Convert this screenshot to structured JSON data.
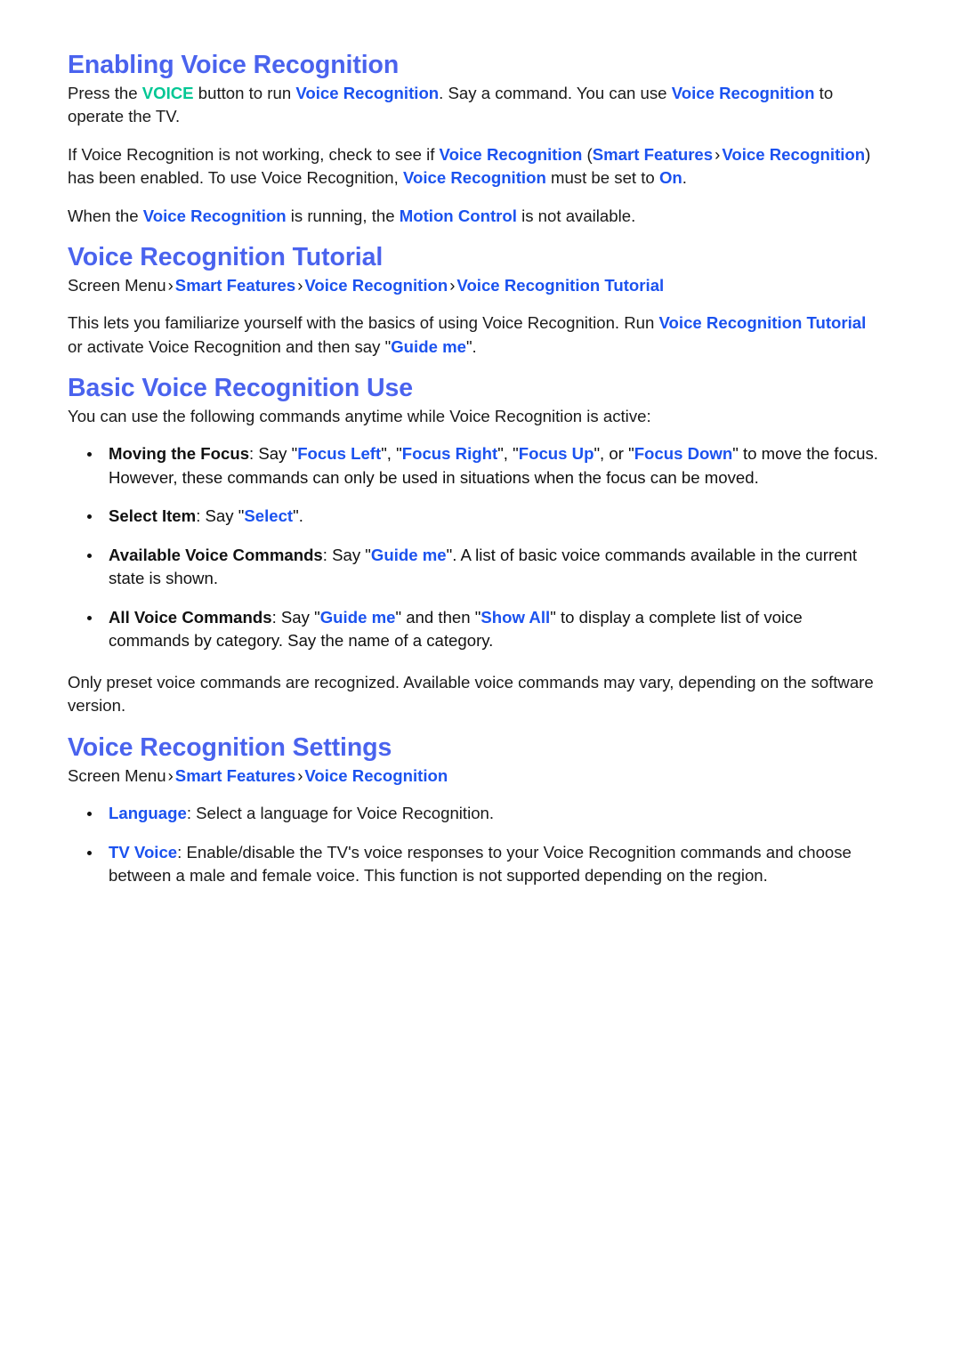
{
  "colors": {
    "heading_blue": "#4a63ee",
    "link_blue": "#1b52ef",
    "accent_green": "#03c794",
    "body_text": "#1a1a1a",
    "page_background": "#ffffff"
  },
  "sections": {
    "enabling": {
      "heading": "Enabling Voice Recognition",
      "p1": {
        "t1": "Press the ",
        "voice_key": "VOICE",
        "t2": " button to run ",
        "link1": "Voice Recognition",
        "t3": ". Say a command. You can use ",
        "link2": "Voice Recognition",
        "t4": " to operate the TV."
      },
      "p2": {
        "t1": "If Voice Recognition is not working, check to see if ",
        "link1": "Voice Recognition",
        "t2": " (",
        "link2": "Smart Features",
        "sep": "›",
        "link3": "Voice Recognition",
        "t3": ") has been enabled. To use Voice Recognition, ",
        "link4": "Voice Recognition",
        "t4": " must be set to ",
        "link5": "On",
        "t5": "."
      },
      "p3": {
        "t1": "When the ",
        "link1": "Voice Recognition",
        "t2": " is running, the ",
        "link2": "Motion Control",
        "t3": " is not available."
      }
    },
    "tutorial": {
      "heading": "Voice Recognition Tutorial",
      "breadcrumb": {
        "root": "Screen Menu",
        "sep": "›",
        "item1": "Smart Features",
        "item2": "Voice Recognition",
        "item3": "Voice Recognition Tutorial"
      },
      "p1": {
        "t1": "This lets you familiarize yourself with the basics of using Voice Recognition. Run ",
        "link1": "Voice Recognition Tutorial",
        "t2": " or activate Voice Recognition and then say \"",
        "link2": "Guide me",
        "t3": "\"."
      }
    },
    "basic": {
      "heading": "Basic Voice Recognition Use",
      "intro": "You can use the following commands anytime while Voice Recognition is active:",
      "bullets": [
        {
          "label": "Moving the Focus",
          "t1": ": Say \"",
          "cmd1": "Focus Left",
          "t2": "\", \"",
          "cmd2": "Focus Right",
          "t3": "\", \"",
          "cmd3": "Focus Up",
          "t4": "\", or \"",
          "cmd4": "Focus Down",
          "t5": "\" to move the focus. However, these commands can only be used in situations when the focus can be moved."
        },
        {
          "label": "Select Item",
          "t1": ": Say \"",
          "cmd1": "Select",
          "t2": "\"."
        },
        {
          "label": "Available Voice Commands",
          "t1": ": Say \"",
          "cmd1": "Guide me",
          "t2": "\". A list of basic voice commands available in the current state is shown."
        },
        {
          "label": "All Voice Commands",
          "t1": ": Say \"",
          "cmd1": "Guide me",
          "t2": "\" and then \"",
          "cmd2": "Show All",
          "t3": "\" to display a complete list of voice commands by category. Say the name of a category."
        }
      ],
      "note": "Only preset voice commands are recognized. Available voice commands may vary, depending on the software version."
    },
    "settings": {
      "heading": "Voice Recognition Settings",
      "breadcrumb": {
        "root": "Screen Menu",
        "sep": "›",
        "item1": "Smart Features",
        "item2": "Voice Recognition"
      },
      "bullets": [
        {
          "label": "Language",
          "text": ": Select a language for Voice Recognition."
        },
        {
          "label": "TV Voice",
          "text": ": Enable/disable the TV's voice responses to your Voice Recognition commands and choose between a male and female voice. This function is not supported depending on the region."
        }
      ]
    }
  }
}
